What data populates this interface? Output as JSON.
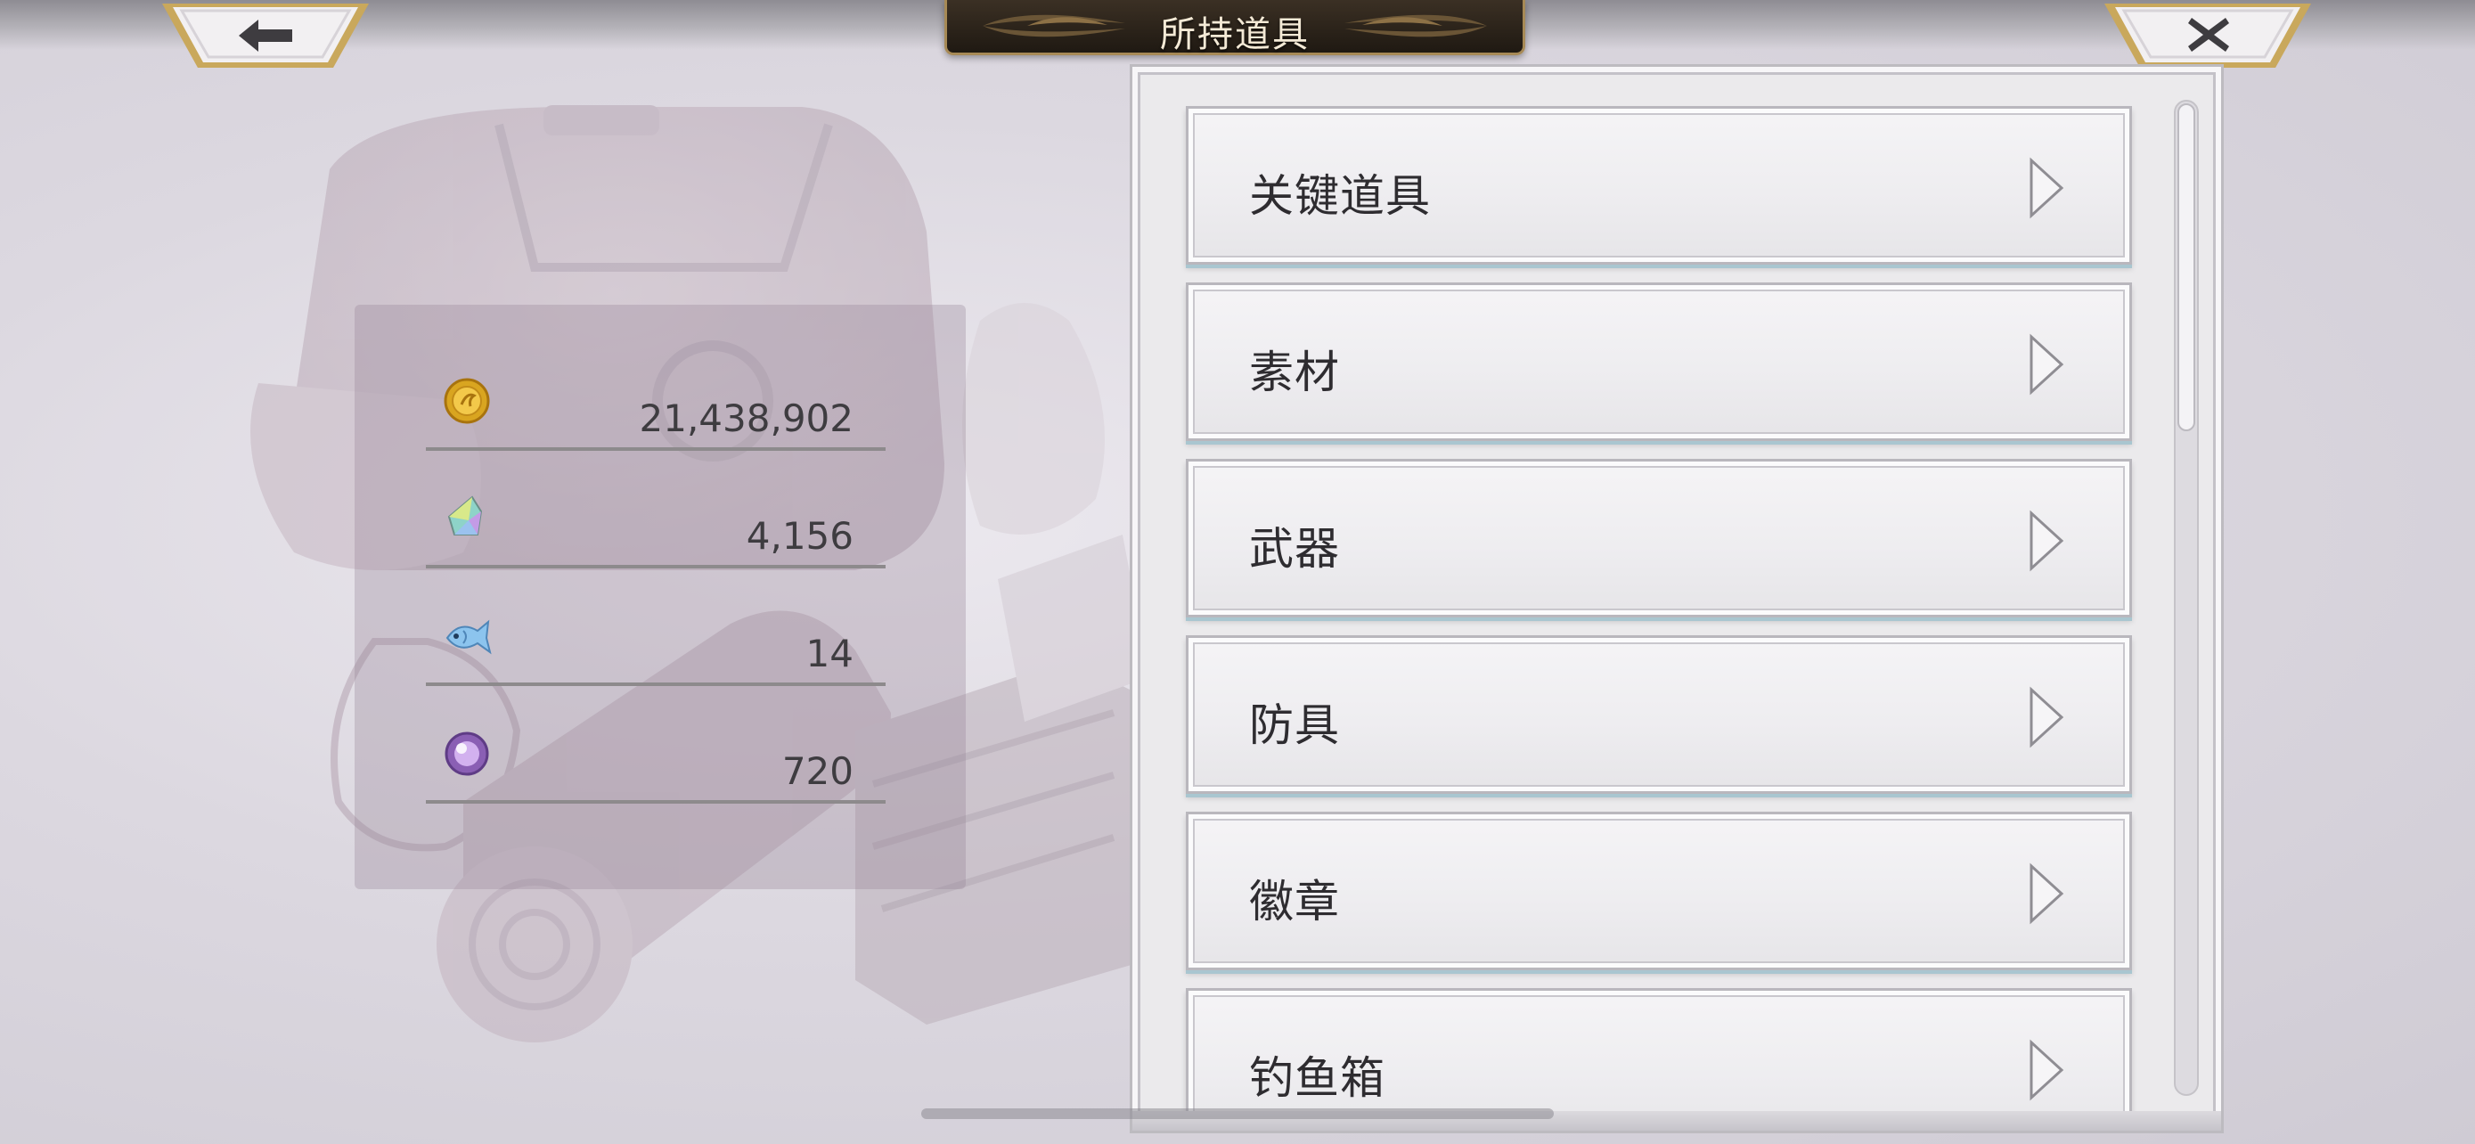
{
  "header": {
    "title": "所持道具",
    "back_icon": "back-arrow-icon",
    "close_icon": "close-x-icon"
  },
  "currencies": [
    {
      "icon": "gold-coin-icon",
      "value": "21,438,902"
    },
    {
      "icon": "rainbow-crystal-icon",
      "value": "4,156"
    },
    {
      "icon": "blue-fish-icon",
      "value": "14"
    },
    {
      "icon": "purple-orb-icon",
      "value": "720"
    }
  ],
  "categories": [
    {
      "label": "关键道具"
    },
    {
      "label": "素材"
    },
    {
      "label": "武器"
    },
    {
      "label": "防具"
    },
    {
      "label": "徽章"
    },
    {
      "label": "钓鱼箱"
    }
  ],
  "colors": {
    "title_plate": "#2a2219",
    "title_text": "#f4ead6",
    "gold_trim": "#c9a85c",
    "panel_bg": "#ebeaec",
    "item_accent": "#a9c6d0"
  }
}
